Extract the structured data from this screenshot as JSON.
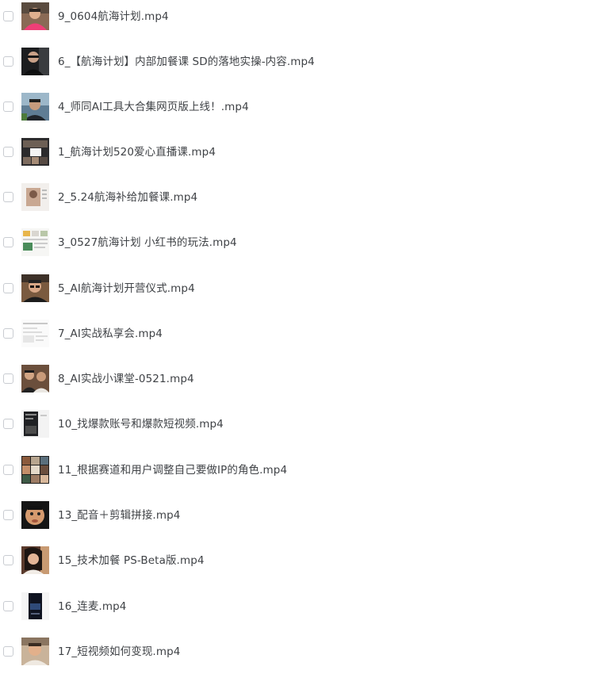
{
  "files": [
    {
      "name": "9_0604航海计划.mp4",
      "thumb": "person-pink-shirt-icon"
    },
    {
      "name": "6_【航海计划】内部加餐课 SD的落地实操-内容.mp4",
      "thumb": "person-dark-room-icon"
    },
    {
      "name": "4_师同AI工具大合集网页版上线！.mp4",
      "thumb": "person-window-icon"
    },
    {
      "name": "1_航海计划520爱心直播课.mp4",
      "thumb": "screen-collage-icon"
    },
    {
      "name": "2_5.24航海补给加餐课.mp4",
      "thumb": "slide-portrait-icon"
    },
    {
      "name": "3_0527航海计划 小红书的玩法.mp4",
      "thumb": "slide-grid-icon"
    },
    {
      "name": "5_AI航海计划开营仪式.mp4",
      "thumb": "person-glasses-icon"
    },
    {
      "name": "7_AI实战私享会.mp4",
      "thumb": "slide-document-icon"
    },
    {
      "name": "8_AI实战小课堂-0521.mp4",
      "thumb": "two-people-icon"
    },
    {
      "name": "10_找爆款账号和爆款短视频.mp4",
      "thumb": "phone-screen-icon"
    },
    {
      "name": "11_根据赛道和用户调整自己要做IP的角色.mp4",
      "thumb": "photo-grid-icon"
    },
    {
      "name": "13_配音＋剪辑拼接.mp4",
      "thumb": "person-face-closeup-icon"
    },
    {
      "name": "15_技术加餐 PS-Beta版.mp4",
      "thumb": "person-woman-icon"
    },
    {
      "name": "16_连麦.mp4",
      "thumb": "phone-dark-icon"
    },
    {
      "name": "17_短视频如何变现.mp4",
      "thumb": "person-bright-icon"
    }
  ]
}
